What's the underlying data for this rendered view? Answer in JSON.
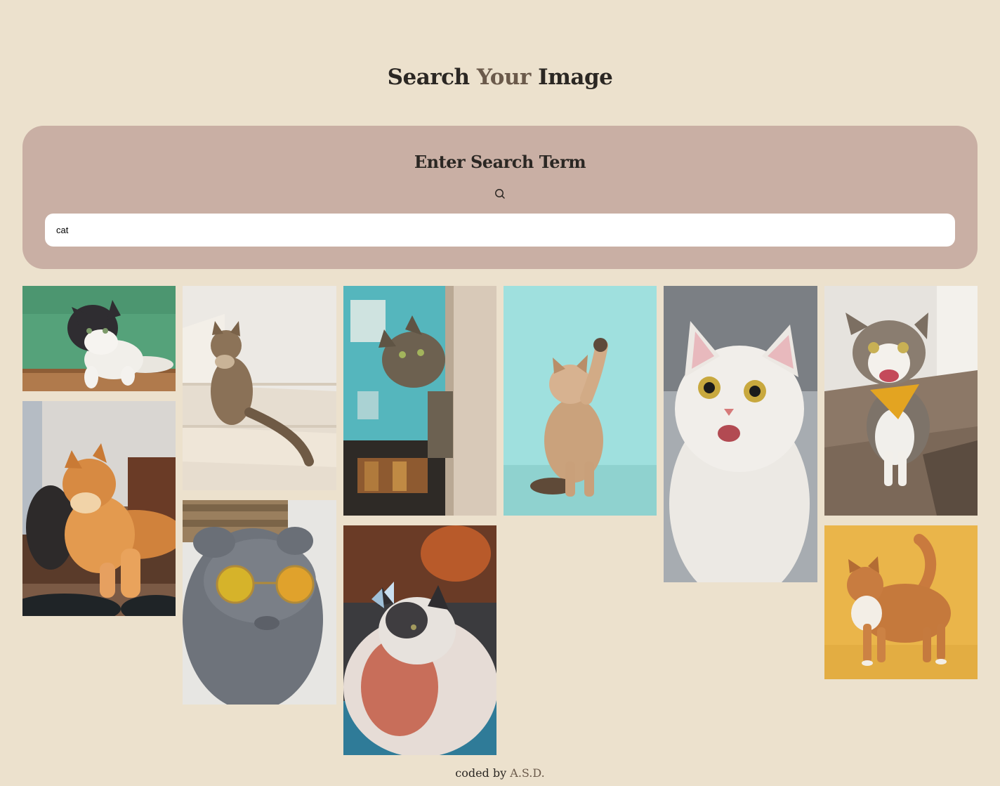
{
  "header": {
    "title_part1": "Search",
    "title_part2": "Your",
    "title_part3": "Image"
  },
  "search": {
    "heading": "Enter Search Term",
    "icon": "search-icon",
    "value": "cat",
    "placeholder": ""
  },
  "gallery": {
    "images": [
      {
        "subject": "black-and-white cat leaning over ledge, green wall"
      },
      {
        "subject": "tabby cat sitting on white stairs"
      },
      {
        "subject": "tabby cat peeking from doorway, teal wall"
      },
      {
        "subject": "fluffy kitten reaching up paw, aqua background"
      },
      {
        "subject": "white cat with wide eyes and open mouth"
      },
      {
        "subject": "happy tabby-and-white cat with yellow bandana on wooden floor"
      },
      {
        "subject": "orange long-haired cat lying on wooden table"
      },
      {
        "subject": "grey fold cat wearing round mirrored sunglasses"
      },
      {
        "subject": "calico cat with butterfly on nose"
      },
      {
        "subject": "orange cat standing, yellow background"
      }
    ]
  },
  "footer": {
    "prefix": "coded by",
    "author": "A.S.D."
  },
  "colors": {
    "background": "#ece1cd",
    "panel": "#c9afa4",
    "accent_text": "#6b5a4b",
    "text": "#2b2723"
  }
}
